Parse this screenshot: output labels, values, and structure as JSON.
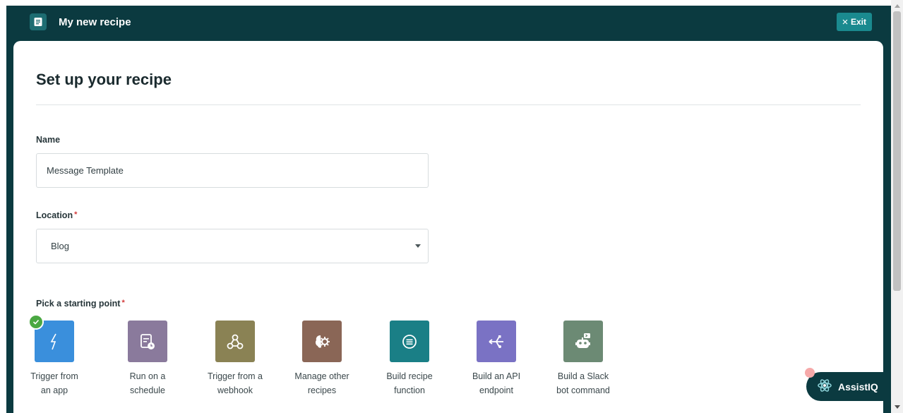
{
  "header": {
    "title": "My new recipe",
    "exit_label": "Exit"
  },
  "panel": {
    "heading": "Set up your recipe",
    "name_label": "Name",
    "name_value": "Message Template",
    "location_label": "Location",
    "location_value": "Blog",
    "required_mark": "*",
    "starting_point_label": "Pick a starting point"
  },
  "starting_points": [
    {
      "line1": "Trigger from",
      "line2": "an app",
      "color": "#3a8fdc",
      "icon": "lightning-icon",
      "selected": true
    },
    {
      "line1": "Run on a",
      "line2": "schedule",
      "color": "#8a7a9c",
      "icon": "schedule-icon",
      "selected": false
    },
    {
      "line1": "Trigger from a",
      "line2": "webhook",
      "color": "#8a8254",
      "icon": "webhook-icon",
      "selected": false
    },
    {
      "line1": "Manage other",
      "line2": "recipes",
      "color": "#8a6656",
      "icon": "gear-brain-icon",
      "selected": false
    },
    {
      "line1": "Build recipe",
      "line2": "function",
      "color": "#1a7f86",
      "icon": "function-icon",
      "selected": false
    },
    {
      "line1": "Build an API",
      "line2": "endpoint",
      "color": "#7a72c4",
      "icon": "api-icon",
      "selected": false
    },
    {
      "line1": "Build a Slack",
      "line2": "bot command",
      "color": "#6c8a74",
      "icon": "slack-bot-icon",
      "selected": false
    }
  ],
  "assistant": {
    "label": "AssistIQ"
  }
}
